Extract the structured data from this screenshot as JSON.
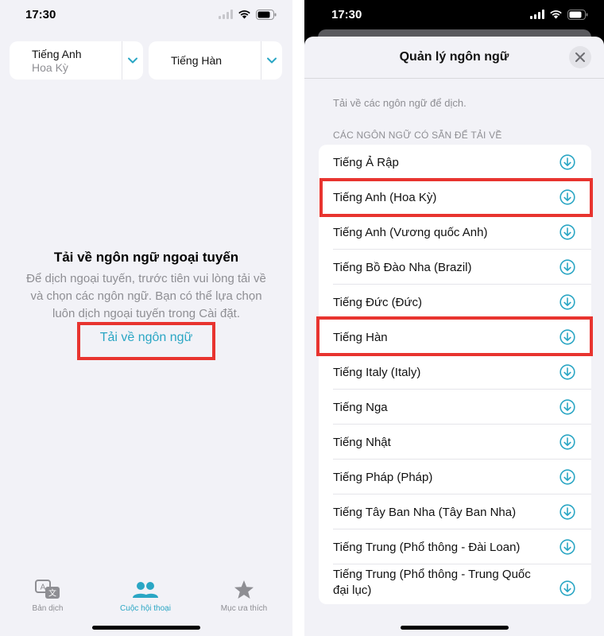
{
  "left": {
    "status_time": "17:30",
    "source_lang": "Tiếng Anh",
    "source_region": "Hoa Kỳ",
    "target_lang": "Tiếng Hàn",
    "offline_title": "Tải về ngôn ngữ ngoại tuyến",
    "offline_desc_1": "Để dịch ngoại tuyến, trước tiên vui lòng tải về",
    "offline_desc_2": "và chọn các ngôn ngữ. Bạn có thể lựa chọn",
    "offline_desc_3": "luôn dịch ngoại tuyến trong Cài đặt.",
    "download_link": "Tải về ngôn ngữ",
    "tabs": [
      {
        "label": "Bản dịch",
        "icon": "translate-icon",
        "active": false
      },
      {
        "label": "Cuộc hội thoại",
        "icon": "people-icon",
        "active": true
      },
      {
        "label": "Mục ưa thích",
        "icon": "star-icon",
        "active": false
      }
    ]
  },
  "right": {
    "status_time": "17:30",
    "sheet_title": "Quản lý ngôn ngữ",
    "description": "Tải về các ngôn ngữ để dịch.",
    "section_header": "CÁC NGÔN NGỮ CÓ SẴN ĐỂ TẢI VỀ",
    "languages": [
      "Tiếng Ả Rập",
      "Tiếng Anh (Hoa Kỳ)",
      "Tiếng Anh (Vương quốc Anh)",
      "Tiếng Bồ Đào Nha (Brazil)",
      "Tiếng Đức (Đức)",
      "Tiếng Hàn",
      "Tiếng Italy (Italy)",
      "Tiếng Nga",
      "Tiếng Nhật",
      "Tiếng Pháp (Pháp)",
      "Tiếng Tây Ban Nha (Tây Ban Nha)",
      "Tiếng Trung (Phổ thông - Đài Loan)",
      "Tiếng Trung (Phổ thông - Trung Quốc đại lục)"
    ]
  },
  "colors": {
    "accent": "#2aa6c4",
    "highlight": "#e8342f",
    "secondary_text": "#8e8e93",
    "background": "#f2f2f7"
  }
}
